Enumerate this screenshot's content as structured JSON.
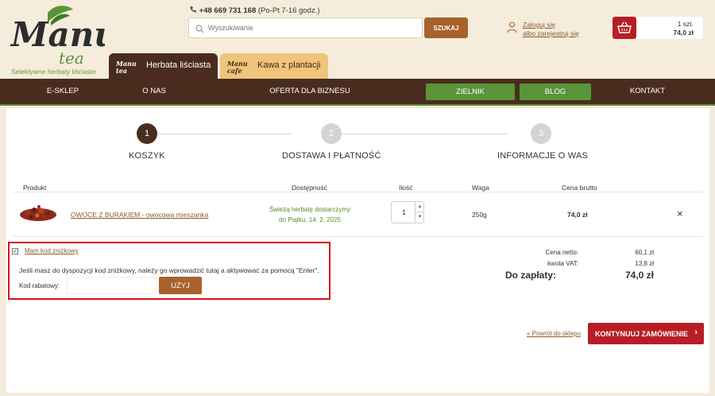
{
  "header": {
    "logo_text": "Manu",
    "logo_sub_text": "tea",
    "logo_tagline": "Selektywne herbaty liściaste",
    "phone_number": "+48 669 731 168",
    "phone_hours": "(Po-Pt 7-16 godz.)",
    "search_placeholder": "Wyszukiwanie",
    "search_button": "SZUKAJ",
    "login_link": "Zaloguj się",
    "register_link": "albo zarejestruj się",
    "cart_quantity": "1 szt.",
    "cart_total": "74,0 zł",
    "tabs": [
      {
        "logo": "Manu tea",
        "label": "Herbata liściasta"
      },
      {
        "logo": "Manu cafe",
        "label": "Kawa z plantacji"
      }
    ]
  },
  "nav": {
    "items": [
      "E-SKLEP",
      "O NAS",
      "OFERTA DLA BIZNESU",
      "ZIELNIK",
      "BLOG",
      "KONTAKT"
    ]
  },
  "steps": [
    {
      "number": "1",
      "label": "KOSZYK",
      "active": true
    },
    {
      "number": "2",
      "label": "DOSTAWA I PŁATNOŚĆ",
      "active": false
    },
    {
      "number": "3",
      "label": "INFORMACJE O WAS",
      "active": false
    }
  ],
  "table": {
    "headers": [
      "Produkt",
      "Dostępność",
      "Ilość",
      "Waga",
      "Cena brutto"
    ],
    "rows": [
      {
        "product": "OWOCE Z BURAKIEM - owocowa mieszanka",
        "availability_line1": "Świeżą herbatę dostarczymy",
        "availability_line2": "do Piątku, 14. 2. 2025",
        "quantity": "1",
        "weight": "250g",
        "price": "74,0 zł",
        "remove": "×"
      }
    ]
  },
  "discount": {
    "checkbox_label": "Mam kod zniżkowy",
    "info_text": "Jeśli masz do dyspozycji kod zniżkowy, należy go wprowadzić tutaj a aktywować za pomocą \"Enter\".",
    "code_label": "Kod rabatowy:",
    "code_value": "",
    "apply_button": "UŻYJ"
  },
  "totals": {
    "net_label": "Cena netto:",
    "net_value": "60,1 zł",
    "vat_label": "kwota VAT:",
    "vat_value": "13,8 zł",
    "pay_label": "Do zapłaty:",
    "pay_value": "74,0 zł"
  },
  "actions": {
    "back_link": "« Powrót do sklepu",
    "continue_button": "KONTYNUUJ ZAMÓWIENIE"
  },
  "colors": {
    "brown_dark": "#4a2c1e",
    "brown_button": "#a8622c",
    "red_accent": "#b81d25",
    "green_nav": "#5a9438",
    "green_text": "#5a8a2a",
    "highlight_box": "#d3131b"
  }
}
